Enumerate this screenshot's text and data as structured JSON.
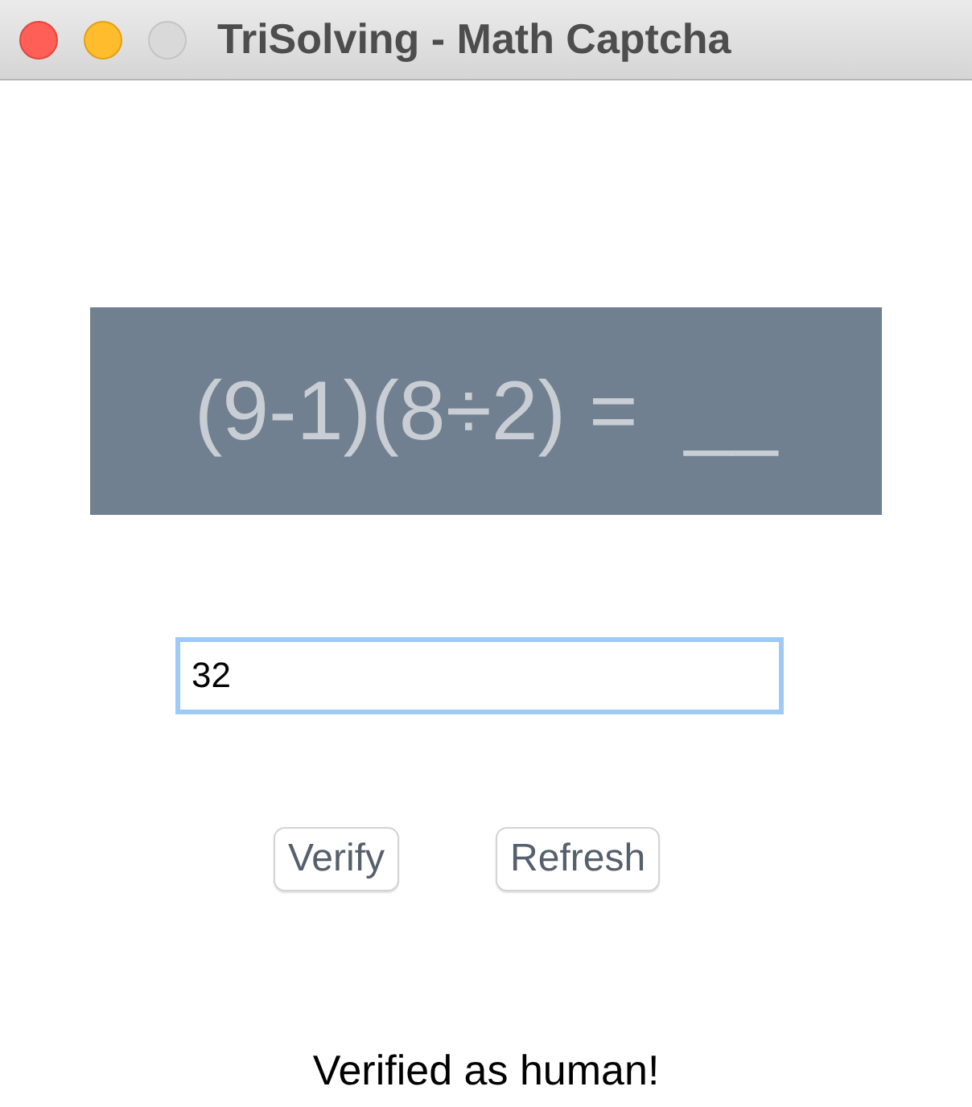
{
  "window": {
    "title": "TriSolving - Math Captcha",
    "controls": [
      {
        "kind": "close",
        "disabled": false
      },
      {
        "kind": "minimize",
        "disabled": false
      },
      {
        "kind": "zoom",
        "disabled": true
      }
    ]
  },
  "captcha": {
    "text": "(9-1)(8÷2) =  __"
  },
  "answer": {
    "value": "32",
    "focused": true
  },
  "buttons": [
    {
      "label": "Verify"
    },
    {
      "label": "Refresh"
    }
  ],
  "status": "Verified as human!"
}
